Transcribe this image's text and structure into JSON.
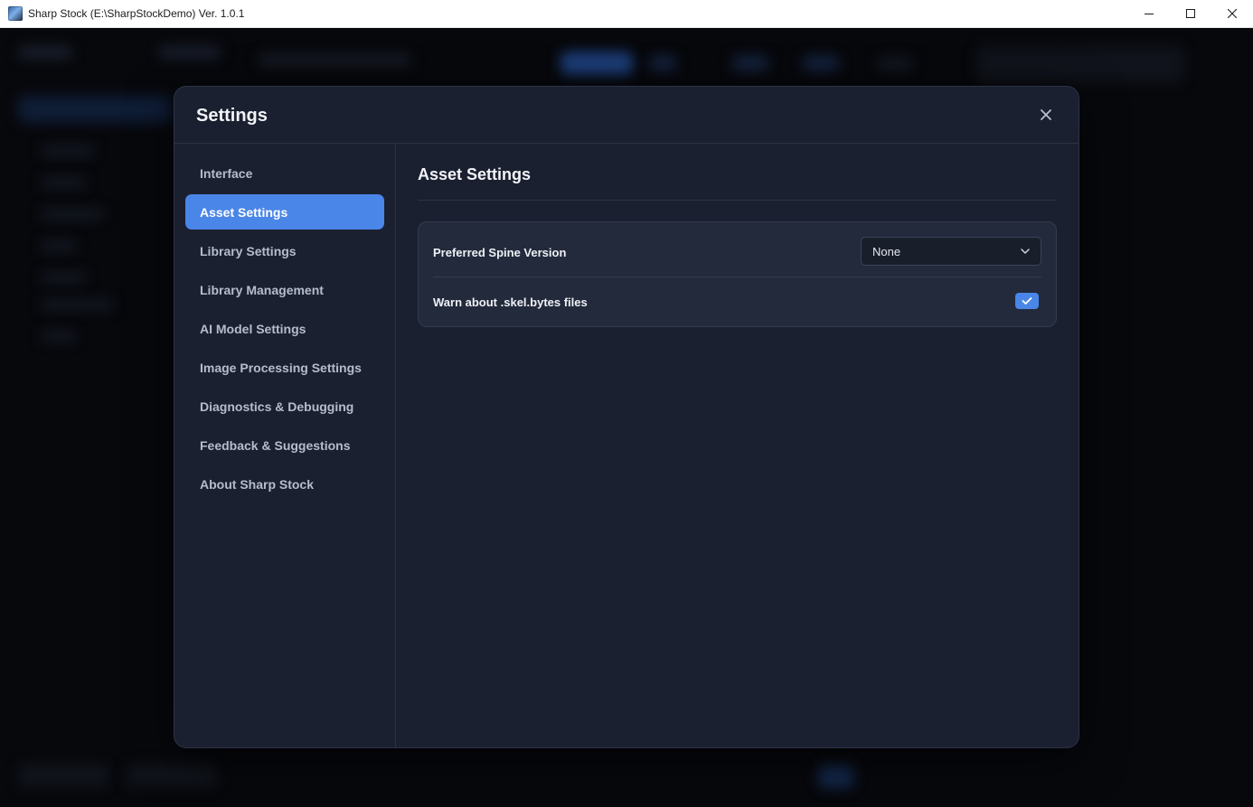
{
  "window": {
    "title": "Sharp Stock (E:\\SharpStockDemo) Ver. 1.0.1",
    "controls": [
      "minimize",
      "maximize",
      "close"
    ]
  },
  "settings": {
    "title": "Settings",
    "close_icon": "close-icon",
    "nav": {
      "items": [
        {
          "label": "Interface",
          "active": false
        },
        {
          "label": "Asset Settings",
          "active": true
        },
        {
          "label": "Library Settings",
          "active": false
        },
        {
          "label": "Library Management",
          "active": false
        },
        {
          "label": "AI Model Settings",
          "active": false
        },
        {
          "label": "Image Processing Settings",
          "active": false
        },
        {
          "label": "Diagnostics & Debugging",
          "active": false
        },
        {
          "label": "Feedback & Suggestions",
          "active": false
        },
        {
          "label": "About Sharp Stock",
          "active": false
        }
      ]
    },
    "section": {
      "title": "Asset Settings",
      "spine_version": {
        "label": "Preferred Spine Version",
        "value": "None"
      },
      "warn_skel_bytes": {
        "label": "Warn about .skel.bytes files",
        "checked": true
      }
    }
  },
  "colors": {
    "accent": "#4a86e8",
    "modal_bg": "#1b2030",
    "card_bg": "#232a3b"
  }
}
